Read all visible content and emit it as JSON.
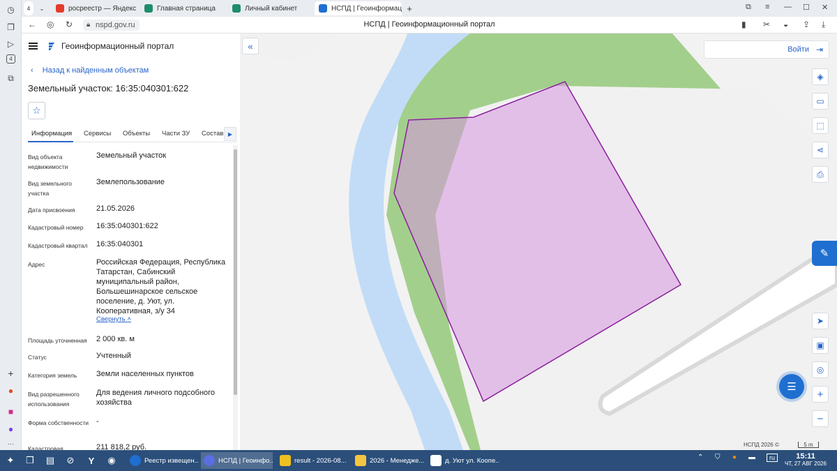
{
  "browser": {
    "tab_count_badge": "4",
    "tabs": [
      {
        "label": "росреестр — Яндекс: наш"
      },
      {
        "label": "Главная страница"
      },
      {
        "label": "Личный кабинет"
      },
      {
        "label": "НСПД | Геоинформац"
      }
    ],
    "url": "nspd.gov.ru",
    "page_title": "НСПД | Геоинформационный портал",
    "rail_badge": "4"
  },
  "app": {
    "title": "Геоинформационный портал",
    "back_label": "Назад к найденным объектам",
    "object_title": "Земельный участок: 16:35:040301:622",
    "tabs": [
      {
        "label": "Информация"
      },
      {
        "label": "Сервисы"
      },
      {
        "label": "Объекты"
      },
      {
        "label": "Части ЗУ"
      },
      {
        "label": "Состав"
      }
    ],
    "info": [
      {
        "label": "Вид объекта недвижимости",
        "value": "Земельный участок"
      },
      {
        "label": "Вид земельного участка",
        "value": "Землепользование"
      },
      {
        "label": "Дата присвоения",
        "value": "21.05.2026"
      },
      {
        "label": "Кадастровый номер",
        "value": "16:35:040301:622"
      },
      {
        "label": "Кадастровый квартал",
        "value": "16:35:040301"
      },
      {
        "label": "Адрес",
        "value": "Российская Федерация, Республика Татарстан, Сабинский муниципальный район, Большешинарское сельское поселение, д. Уют, ул. Кооперативная, з/у 34"
      },
      {
        "label": "Площадь уточненная",
        "value": "2 000 кв. м"
      },
      {
        "label": "Статус",
        "value": "Учтенный"
      },
      {
        "label": "Категория земель",
        "value": "Земли населенных пунктов"
      },
      {
        "label": "Вид разрешенного использования",
        "value": "Для ведения личного подсобного хозяйства"
      },
      {
        "label": "Форма собственности",
        "value": "-"
      },
      {
        "label": "Кадастровая",
        "value": "211 818,2 руб."
      }
    ],
    "collapse_label": "Свернуть"
  },
  "map": {
    "login_label": "Войти",
    "copyright": "НСПД 2026 ©",
    "scale": "5 m",
    "colors": {
      "water": "#c2dcf7",
      "green": "#a3cf8c",
      "parcel_fill": "#e0b4e6",
      "parcel_stroke": "#8a1f9c",
      "road": "#ffffff"
    }
  },
  "taskbar": {
    "tasks": [
      {
        "label": "Реестр извещен..."
      },
      {
        "label": "НСПД | Геоинфо..."
      },
      {
        "label": "result - 2026-08..."
      },
      {
        "label": "2026 - Менедже..."
      },
      {
        "label": "д. Уют ул. Коопе..."
      }
    ],
    "lang": "ru",
    "time": "15:11",
    "date": "ЧТ, 27 АВГ 2026"
  }
}
